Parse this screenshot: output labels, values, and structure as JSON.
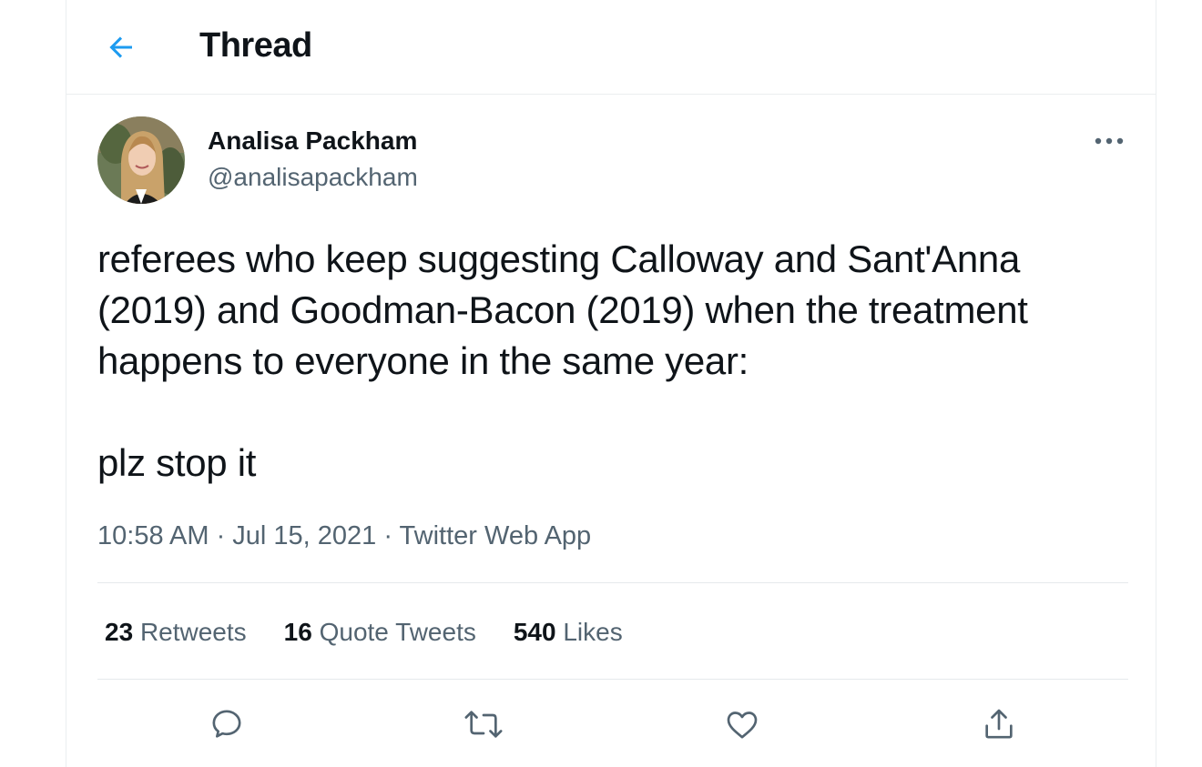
{
  "header": {
    "back_icon": "arrow-left-icon",
    "title": "Thread"
  },
  "tweet": {
    "author": {
      "name": "Analisa Packham",
      "handle": "@analisapackham"
    },
    "more_icon": "more-horizontal-icon",
    "text": "referees who keep suggesting Calloway and Sant'Anna (2019) and Goodman-Bacon (2019) when the treatment happens to everyone in the same year:\n\nplz stop it",
    "meta": "10:58 AM · Jul 15, 2021 · Twitter Web App",
    "stats": [
      {
        "count": "23",
        "label": "Retweets"
      },
      {
        "count": "16",
        "label": "Quote Tweets"
      },
      {
        "count": "540",
        "label": "Likes"
      }
    ],
    "actions": [
      "reply-icon",
      "retweet-icon",
      "like-icon",
      "share-icon"
    ]
  },
  "colors": {
    "accent": "#1d9bf0",
    "text": "#0f1419",
    "secondary": "#536471",
    "border": "#ebeef0"
  }
}
